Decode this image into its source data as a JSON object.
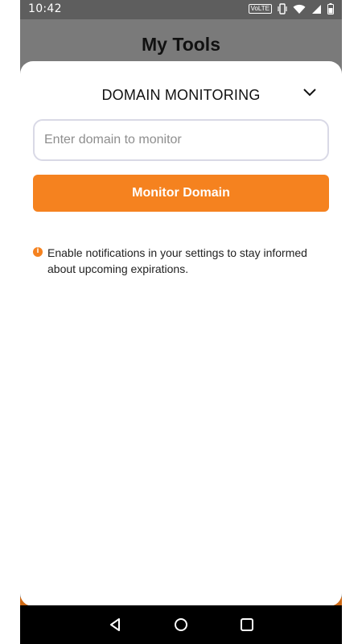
{
  "status_bar": {
    "time": "10:42",
    "network_label": "VoLTE",
    "icons": [
      "volte-icon",
      "vibrate-icon",
      "wifi-icon",
      "signal-icon",
      "battery-icon"
    ]
  },
  "header": {
    "title": "My Tools"
  },
  "sheet": {
    "title": "DOMAIN MONITORING",
    "toggle_icon": "chevron-down-icon",
    "domain_input": {
      "value": "",
      "placeholder": "Enter domain to monitor"
    },
    "primary_button_label": "Monitor Domain",
    "notice": {
      "icon": "info-icon",
      "text": "Enable notifications in your settings to stay informed about upcoming expirations."
    }
  },
  "nav_bar": {
    "back_icon": "back-icon",
    "home_icon": "home-icon",
    "recents_icon": "recents-icon"
  },
  "colors": {
    "accent": "#f5821f",
    "status_bar_bg": "#5e5e5e",
    "header_bg": "#7a7a7a",
    "nav_bg": "#000000"
  }
}
